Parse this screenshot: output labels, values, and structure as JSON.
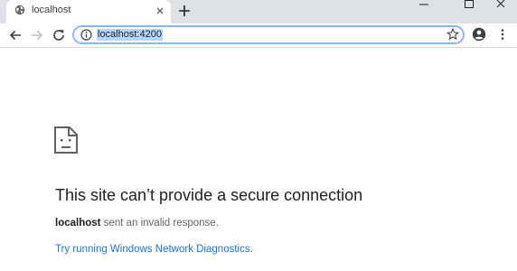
{
  "tab": {
    "title": "localhost"
  },
  "omnibox": {
    "url": "localhost:4200"
  },
  "error": {
    "heading": "This site can’t provide a secure connection",
    "host": "localhost",
    "detail_suffix": " sent an invalid response.",
    "link_text": "Try running Windows Network Diagnostics."
  },
  "colors": {
    "link": "#1a73e8",
    "url_selection": "#b3d7ff",
    "tabstrip": "#dee1e6"
  },
  "icons": {
    "tab_favicon": "globe-icon",
    "error": "sad-page-icon",
    "site_info": "info-icon",
    "bookmark": "star-icon",
    "account": "account-icon",
    "menu": "kebab-menu-icon"
  }
}
